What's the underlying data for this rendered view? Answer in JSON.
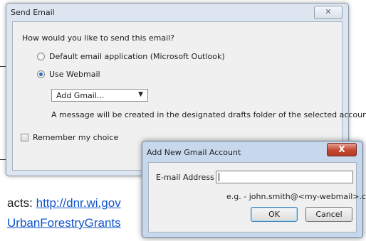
{
  "background": {
    "contacts_prefix": "acts: ",
    "contacts_link": "http://dnr.wi.gov",
    "grants_link": "UrbanForestryGrants"
  },
  "send_dialog": {
    "title": "Send Email",
    "close_label": "✕",
    "question": "How would you like to send this email?",
    "options": [
      {
        "label": "Default email application (Microsoft Outlook)",
        "selected": false
      },
      {
        "label": "Use Webmail",
        "selected": true
      }
    ],
    "account_select": {
      "value": "Add Gmail..."
    },
    "note": "A message will be created in the designated drafts folder of the selected account.",
    "remember_label": "Remember my choice"
  },
  "gmail_dialog": {
    "title": "Add New Gmail Account",
    "close_label": "X",
    "email_label": "E-mail Address",
    "email_value": "",
    "hint": "e.g. - john.smith@<my-webmail>.com",
    "ok_label": "OK",
    "cancel_label": "Cancel"
  },
  "colors": {
    "accent": "#2b6ac3",
    "link": "#1155cc",
    "close_red": "#c2472f"
  }
}
